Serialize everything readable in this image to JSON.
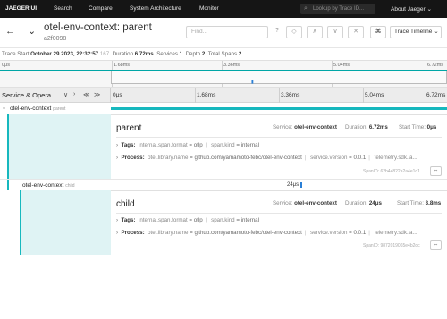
{
  "nav": {
    "brand": "JAEGER UI",
    "items": [
      "Search",
      "Compare",
      "System Architecture",
      "Monitor"
    ],
    "lookup_placeholder": "Lookup by Trace ID...",
    "about": "About Jaeger"
  },
  "trace": {
    "title": "otel-env-context: parent",
    "id": "a2f0098",
    "find_placeholder": "Find...",
    "view_button": "Trace Timeline",
    "meta": {
      "start_label": "Trace Start",
      "start_value": "October 29 2023, 22:32:57",
      "start_ms": ".167",
      "duration_label": "Duration",
      "duration_value": "6.72ms",
      "services_label": "Services",
      "services_value": "1",
      "depth_label": "Depth",
      "depth_value": "2",
      "spans_label": "Total Spans",
      "spans_value": "2"
    }
  },
  "minimap": {
    "ticks": [
      "0μs",
      "1.68ms",
      "3.36ms",
      "5.04ms",
      "6.72ms"
    ]
  },
  "columns": {
    "service_header": "Service & Opera...",
    "ticks": [
      "0μs",
      "1.68ms",
      "3.36ms",
      "5.04ms",
      "6.72ms"
    ]
  },
  "spans": [
    {
      "service": "otel-env-context",
      "operation": "parent",
      "title": "parent",
      "service_label": "Service:",
      "service_value": "otel-env-context",
      "duration_label": "Duration:",
      "duration_value": "6.72ms",
      "start_label": "Start Time:",
      "start_value": "0μs",
      "tags_label": "Tags:",
      "tags": [
        {
          "key": "internal.span.format",
          "value": "otlp"
        },
        {
          "key": "span.kind",
          "value": "internal"
        }
      ],
      "process_label": "Process:",
      "process": [
        {
          "key": "otel.library.name",
          "value": "github.com/yamamoto-febc/otel-env-context"
        },
        {
          "key": "service.version",
          "value": "0.0.1"
        },
        {
          "key": "telemetry.sdk.la...",
          "value": ""
        }
      ],
      "span_id": "SpanID: 62b4e822a2a4e1d1"
    },
    {
      "service": "otel-env-context",
      "operation": "child",
      "bar_label": "24μs",
      "title": "child",
      "service_label": "Service:",
      "service_value": "otel-env-context",
      "duration_label": "Duration:",
      "duration_value": "24μs",
      "start_label": "Start Time:",
      "start_value": "3.8ms",
      "tags_label": "Tags:",
      "tags": [
        {
          "key": "internal.span.format",
          "value": "otlp"
        },
        {
          "key": "span.kind",
          "value": "internal"
        }
      ],
      "process_label": "Process:",
      "process": [
        {
          "key": "otel.library.name",
          "value": "github.com/yamamoto-febc/otel-env-context"
        },
        {
          "key": "service.version",
          "value": "0.0.1"
        },
        {
          "key": "telemetry.sdk.la...",
          "value": ""
        }
      ],
      "span_id": "SpanID: 9872019065e4b2dc"
    }
  ],
  "colors": {
    "nav_bg": "#151515",
    "span_teal": "#17b8be",
    "panel_tint": "#dff3f4"
  },
  "icons": {
    "back": "arrow-left-icon",
    "collapse": "chevron-down-icon",
    "help": "help-icon",
    "keyboard": "command-key-icon",
    "copy": "copy-link-icon"
  }
}
